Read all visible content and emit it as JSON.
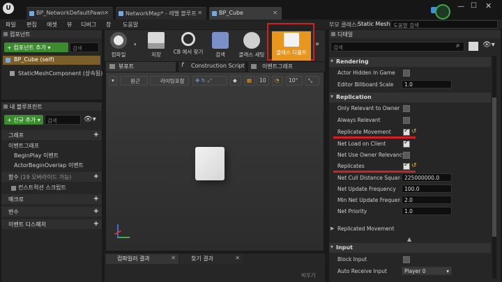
{
  "tabs": [
    {
      "label": "BP_NetworkDefaultPawn"
    },
    {
      "label": "NetworkMap* - 레벨 블루프"
    },
    {
      "label": "BP_Cube"
    }
  ],
  "parent_class": {
    "label": "부모 클래스:",
    "value": "Static Mesh Actor"
  },
  "menu": [
    "파일",
    "편집",
    "애셋",
    "뷰",
    "디버그",
    "창",
    "도움말"
  ],
  "help_search_placeholder": "도움말 검색",
  "components": {
    "title": "컴포넌트",
    "add_button": "+ 컴포넌트 추가 ▾",
    "search_placeholder": "검색",
    "items": [
      "BP_Cube (self)",
      "StaticMeshComponent (상속됨)"
    ]
  },
  "my_blueprint": {
    "title": "내 블루프린트",
    "new_button": "+ 신규 추가 ▾",
    "search_placeholder": "검색",
    "sections": [
      {
        "label": "그래프"
      },
      {
        "label": "이벤트그래프"
      },
      {
        "label": "BeginPlay 이벤트"
      },
      {
        "label": "ActorBeginOverlap 이벤트"
      },
      {
        "label": "함수"
      },
      {
        "label": "(19 오버라이드 가능)"
      },
      {
        "label": "컨스트럭션 스크립트"
      },
      {
        "label": "매크로"
      },
      {
        "label": "변수"
      },
      {
        "label": "이벤트 디스패처"
      }
    ]
  },
  "toolbar": [
    {
      "label": "컴파일",
      "icon": "compile-icon"
    },
    {
      "label": "저장",
      "icon": "save-icon"
    },
    {
      "label": "CB 에서 찾기",
      "icon": "find-in-cb-icon"
    },
    {
      "label": "검색",
      "icon": "search-icon"
    },
    {
      "label": "클래스 세팅",
      "icon": "class-settings-icon"
    },
    {
      "label": "클래스 디폴트",
      "icon": "class-defaults-icon"
    }
  ],
  "editor_tabs": [
    "뷰포트",
    "Construction Script",
    "이벤트그래프"
  ],
  "viewport_toolbar": {
    "view_mode": "원근",
    "lighting": "라이팅포함",
    "grid": "10",
    "angle": "10°"
  },
  "bottom_tabs": [
    "컴파일러 결과",
    "찾기 결과"
  ],
  "bottom_clear": "비우기",
  "details": {
    "title": "디테일",
    "search_placeholder": "검색",
    "rendering": {
      "title": "Rendering",
      "rows": [
        {
          "label": "Actor Hidden In Game",
          "type": "check",
          "checked": false
        },
        {
          "label": "Editor Billboard Scale",
          "type": "number",
          "value": "1.0"
        }
      ]
    },
    "replication": {
      "title": "Replication",
      "rows": [
        {
          "label": "Only Relevant to Owner",
          "type": "check",
          "checked": false
        },
        {
          "label": "Always Relevant",
          "type": "check",
          "checked": false
        },
        {
          "label": "Replicate Movement",
          "type": "check",
          "checked": true
        },
        {
          "label": "Net Load on Client",
          "type": "check",
          "checked": true
        },
        {
          "label": "Net Use Owner Relevancy",
          "type": "check",
          "checked": false
        },
        {
          "label": "Replicates",
          "type": "check",
          "checked": true
        },
        {
          "label": "Net Cull Distance Squared",
          "type": "number",
          "value": "225000000.0"
        },
        {
          "label": "Net Update Frequency",
          "type": "number",
          "value": "100.0"
        },
        {
          "label": "Min Net Update Frequency",
          "type": "number",
          "value": "2.0"
        },
        {
          "label": "Net Priority",
          "type": "number",
          "value": "1.0"
        }
      ],
      "subgroup": "Replicated Movement"
    },
    "input": {
      "title": "Input",
      "rows": [
        {
          "label": "Block Input",
          "type": "check",
          "checked": false
        },
        {
          "label": "Auto Receive Input",
          "type": "select",
          "value": "Player 0"
        }
      ]
    }
  },
  "colors": {
    "accent_orange": "#e8961e",
    "highlight_red": "#d42020",
    "add_green": "#3c8b2f"
  }
}
